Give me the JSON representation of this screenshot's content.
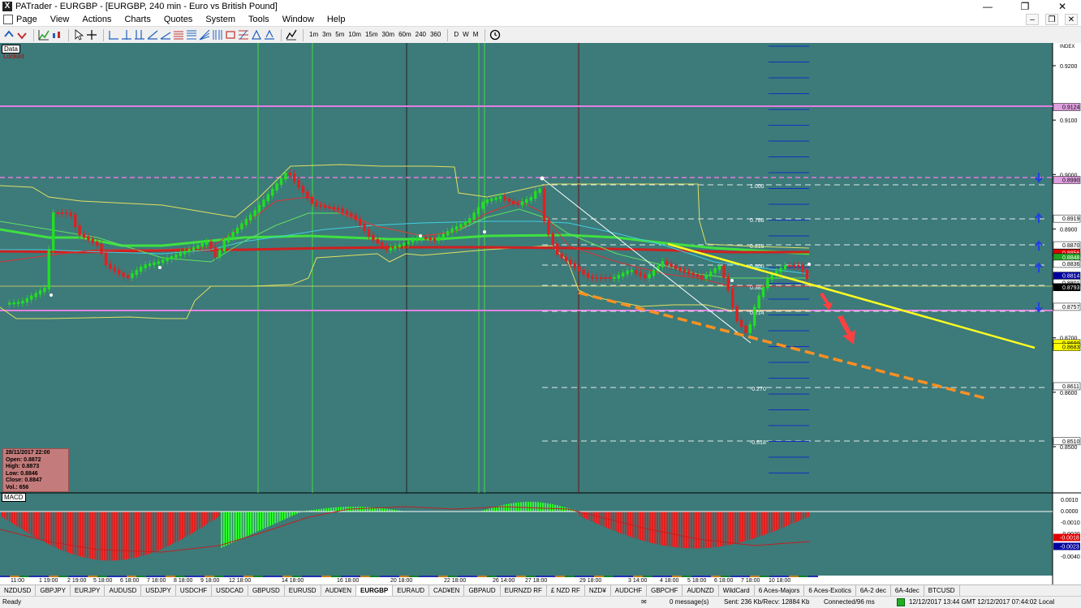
{
  "window": {
    "title": "PATrader - EURGBP - [EURGBP, 240 min - Euro vs British Pound]",
    "app_icon": "X",
    "controls": [
      "—",
      "❐",
      "✕"
    ],
    "mdi_controls": [
      "–",
      "❐",
      "✕"
    ]
  },
  "menu": [
    "Page",
    "View",
    "Actions",
    "Charts",
    "Quotes",
    "System",
    "Tools",
    "Window",
    "Help"
  ],
  "toolbar": {
    "timeframes": [
      "1m",
      "3m",
      "5m",
      "10m",
      "15m",
      "30m",
      "60m",
      "240",
      "360"
    ],
    "periods": [
      "D",
      "W",
      "M"
    ]
  },
  "chart": {
    "data_label": "Data",
    "locked_label": "Locked",
    "axis_label": "INDEX",
    "price_ticks": [
      "0.9200",
      "0.9100",
      "0.9000",
      "0.8900",
      "0.8800",
      "0.8700",
      "0.8600",
      "0.8500"
    ],
    "price_markers": [
      {
        "label": "0.9124",
        "color": "#e0a0e0"
      },
      {
        "label": "0.8990",
        "color": "#e0a0e0"
      },
      {
        "label": "0.8919",
        "color": "#ffffff"
      },
      {
        "label": "0.8870",
        "color": "#ffffff"
      },
      {
        "label": "0.8856",
        "color": "#e00000"
      },
      {
        "label": "0.8848",
        "color": "#20a020"
      },
      {
        "label": "0.8836",
        "color": "#ffffff"
      },
      {
        "label": "0.8814",
        "color": "#0000a0"
      },
      {
        "label": "0.8801",
        "color": "#ffffff"
      },
      {
        "label": "0.8793",
        "color": "#000000"
      },
      {
        "label": "0.8757",
        "color": "#ffffff"
      },
      {
        "label": "0.8690",
        "color": "#ffff00"
      },
      {
        "label": "0.8683",
        "color": "#ffff00"
      },
      {
        "label": "0.8611",
        "color": "#ffffff"
      },
      {
        "label": "0.8510",
        "color": "#ffffff"
      }
    ],
    "fib_labels": [
      "1.000",
      "0.786",
      "0.618",
      "0.500",
      "0.382",
      "0.214",
      "-0.270",
      "-0.618"
    ],
    "time_labels": [
      "11:00",
      "1 19:00",
      "2 19:00",
      "5 18:00",
      "6 18:00",
      "7 18:00",
      "8 18:00",
      "9 18:00",
      "12 18:00",
      "14 18:00",
      "16 18:00",
      "20 18:00",
      "22 18:00",
      "26 14:00",
      "27 18:00",
      "29 18:00",
      "3 14:00",
      "4 18:00",
      "5 18:00",
      "6 18:00",
      "7 18:00",
      "10 18:00"
    ],
    "ohlc": {
      "date": "28/11/2017 22:00",
      "open": "Open: 0.8872",
      "high": "High: 0.8873",
      "low": "Low: 0.8846",
      "close": "Close: 0.8847",
      "vol": "Vol.: 656"
    },
    "macd_label": "MACD",
    "macd_ticks": [
      "0.0010",
      "0.0000",
      "-0.0010",
      "-0.0020",
      "-0.0030",
      "-0.0040"
    ],
    "macd_markers": [
      {
        "label": "-0.0018",
        "color": "#e00000"
      },
      {
        "label": "-0.0023",
        "color": "#0000a0"
      }
    ],
    "colors": {
      "background": "#3d7a7a",
      "bull": "#20e020",
      "bear": "#e02020",
      "band": "#e0e060",
      "trendline_yellow": "#ffff20",
      "trendline_orange": "#ff9020",
      "arrow": "#ff4040",
      "magenta_line": "#e080e0"
    }
  },
  "symbols": [
    "NZDUSD",
    "GBPJPY",
    "EURJPY",
    "AUDUSD",
    "USDJPY",
    "USDCHF",
    "USDCAD",
    "GBPUSD",
    "EURUSD",
    "AUD¥EN",
    "EURGBP",
    "EURAUD",
    "CAD¥EN",
    "GBPAUD",
    "EURNZD RF",
    "£ NZD RF",
    "NZD¥",
    "AUDCHF",
    "GBPCHF",
    "AUDNZD",
    "WildCard",
    "6 Aces-Majors",
    "6 Aces-Exotics",
    "6A-2 dec",
    "6A-4dec",
    "BTCUSD"
  ],
  "active_symbol": "EURGBP",
  "status": {
    "ready": "Ready",
    "messages": "0 message(s)",
    "traffic": "Sent: 236 Kb/Recv: 12884 Kb",
    "connection": "Connected/96 ms",
    "time": "12/12/2017 13:44 GMT  12/12/2017 07:44:02 Local"
  }
}
